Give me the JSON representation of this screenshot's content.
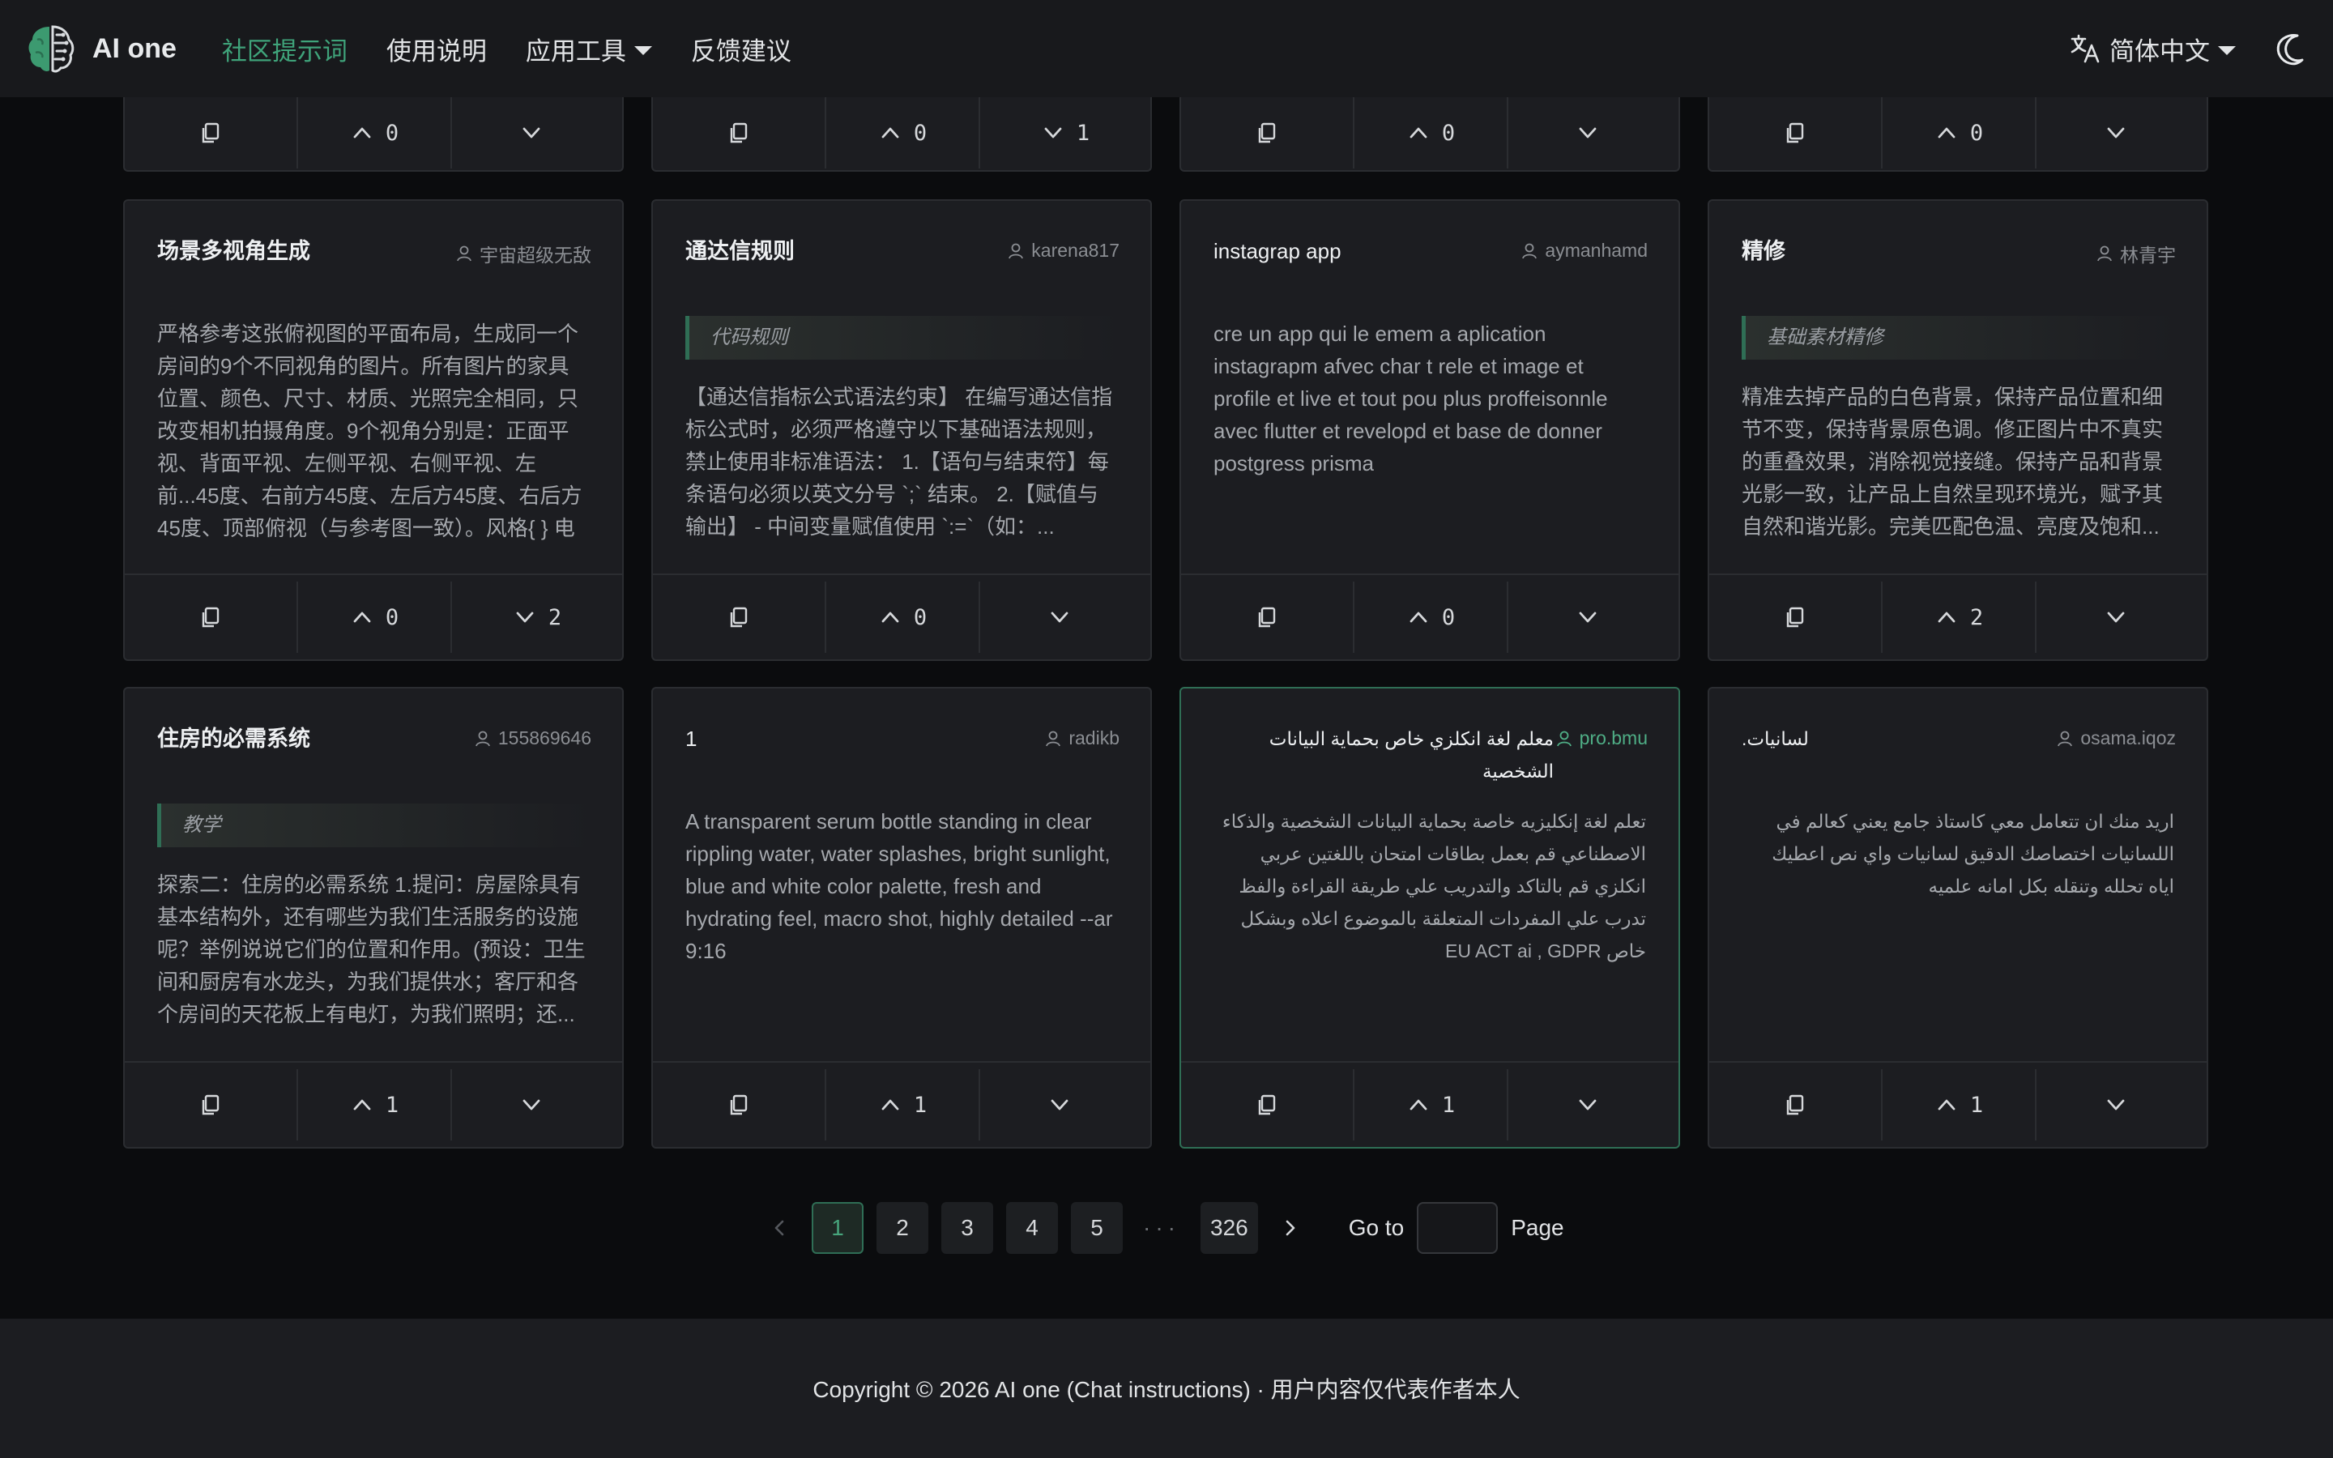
{
  "header": {
    "brand": "AI one",
    "nav": [
      "社区提示词",
      "使用说明",
      "应用工具",
      "反馈建议"
    ],
    "language": "简体中文"
  },
  "top_row": [
    {
      "up": "0",
      "down": ""
    },
    {
      "up": "0",
      "down": "1"
    },
    {
      "up": "0",
      "down": ""
    },
    {
      "up": "0",
      "down": ""
    }
  ],
  "cards": [
    {
      "title": "场景多视角生成",
      "author": "宇宙超级无敌",
      "tag": "",
      "body": "严格参考这张俯视图的平面布局，生成同一个房间的9个不同视角的图片。所有图片的家具位置、颜色、尺寸、材质、光照完全相同，只改变相机拍摄角度。9个视角分别是：正面平视、背面平视、左侧平视、右侧平视、左前...45度、右前方45度、左后方45度、右后方45度、顶部俯视（与参考图一致）。风格{ } 电影",
      "up": "0",
      "down": "2"
    },
    {
      "title": "通达信规则",
      "author": "karena817",
      "tag": "代码规则",
      "body": "【通达信指标公式语法约束】 在编写通达信指标公式时，必须严格遵守以下基础语法规则，禁止使用非标准语法： 1.【语句与结束符】每条语句必须以英文分号 `;` 结束。 2.【赋值与输出】 - 中间变量赋值使用 `:=`（如：...",
      "up": "0",
      "down": ""
    },
    {
      "title": "instagrap app",
      "author": "aymanhamd",
      "tag": "",
      "body": "cre un app qui le emem a aplication instagrapm afvec char t rele et image et profile et live et tout pou plus proffeisonnle avec flutter et revelopd et base de donner postgress prisma",
      "up": "0",
      "down": ""
    },
    {
      "title": "精修",
      "author": "林青宇",
      "tag": "基础素材精修",
      "body": "精准去掉产品的白色背景，保持产品位置和细节不变，保持背景原色调。修正图片中不真实的重叠效果，消除视觉接缝。保持产品和背景光影一致，让产品上自然呈现环境光，赋予其自然和谐光影。完美匹配色温、亮度及饱和...",
      "up": "2",
      "down": ""
    },
    {
      "title": "住房的必需系统",
      "author": "155869646",
      "tag": "教学",
      "body": "探索二：住房的必需系统 1.提问：房屋除具有基本结构外，还有哪些为我们生活服务的设施呢？举例说说它们的位置和作用。(预设：卫生间和厨房有水龙头，为我们提供水；客厅和各个房间的天花板上有电灯，为我们照明；还...",
      "up": "1",
      "down": ""
    },
    {
      "title": "1",
      "author": "radikb",
      "tag": "",
      "body": "A transparent serum bottle standing in clear rippling water, water splashes, bright sunlight, blue and white color palette, fresh and hydrating feel, macro shot, highly detailed --ar 9:16",
      "up": "1",
      "down": ""
    },
    {
      "title": "معلم لغة انكلزي خاص بحماية البيانات الشخصية",
      "author": "pro.bmu",
      "tag": "",
      "body": "تعلم لغة إنكليزيه خاصة بحماية البيانات الشخصية والذكاء الاصطناعي قم بعمل بطاقات امتحان باللغتين عربي انكلزي قم بالتاكد والتدريب علي طريقة القراءة والفظ تدرب علي المفردات المتعلقة بالموضوع اعلاه وبشكل خاص EU ACT ai , GDPR",
      "up": "1",
      "down": ""
    },
    {
      "title": "لسانيات.",
      "author": "osama.iqoz",
      "tag": "",
      "body": "اريد منك ان تتعامل معي كاستاذ جامع يعني كعالم في اللسانيات اختصاصك الدقيق لسانيات واي نص اعطيك اياه تحلله وتنقله بكل امانه علميه",
      "up": "1",
      "down": ""
    }
  ],
  "pagination": {
    "pages": [
      "1",
      "2",
      "3",
      "4",
      "5"
    ],
    "dots": "···",
    "last": "326",
    "goto_label": "Go to",
    "page_label": "Page",
    "goto_value": ""
  },
  "footer": {
    "text": "Copyright © 2026 AI one (Chat instructions) · 用户内容仅代表作者本人"
  },
  "colors": {
    "accent": "#3fa37a",
    "background": "#0b0c0e",
    "card": "#1c1d21",
    "header": "#18191c"
  }
}
